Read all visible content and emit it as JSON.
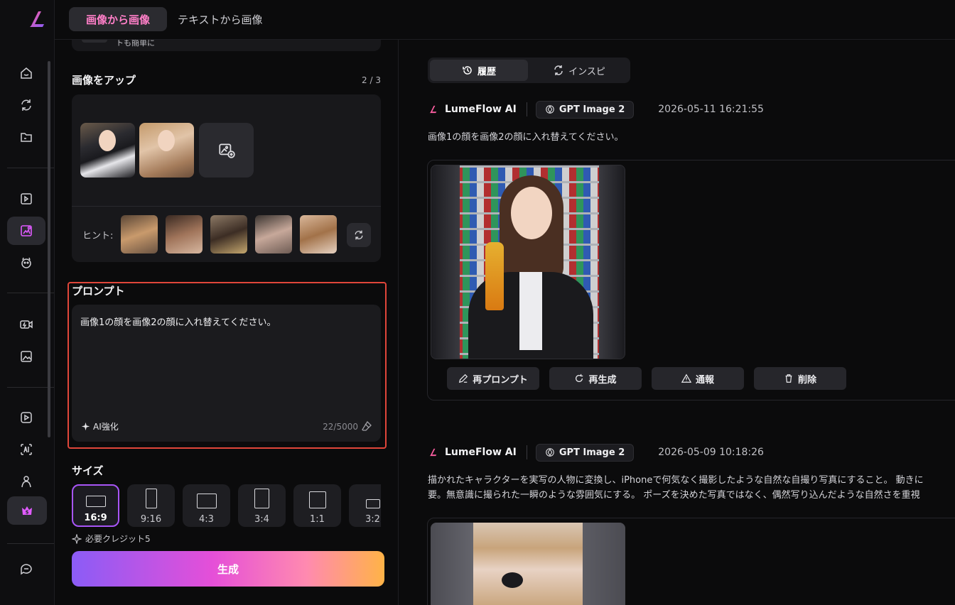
{
  "header": {
    "tabs": [
      {
        "label": "画像から画像",
        "active": true
      },
      {
        "label": "テキストから画像",
        "active": false
      }
    ]
  },
  "sidebar": {
    "icons": [
      "home-icon",
      "refresh-icon",
      "folder-icon",
      "ai-video-icon",
      "image-edit-icon",
      "pet-icon",
      "camera-icon",
      "image-icon",
      "video-play-icon",
      "ai-text-icon",
      "avatar-icon",
      "premium-icon",
      "chat-icon"
    ]
  },
  "left_panel": {
    "previous_card_text": "トも簡単に",
    "upload": {
      "title": "画像をアップ",
      "count": "2 / 3",
      "hint_label": "ヒント:"
    },
    "prompt": {
      "title": "プロンプト",
      "text": "画像1の顔を画像2の顔に入れ替えてください。",
      "ai_enhance": "AI強化",
      "char_count": "22/5000"
    },
    "size": {
      "title": "サイズ",
      "options": [
        "16:9",
        "9:16",
        "4:3",
        "3:4",
        "1:1",
        "3:2"
      ],
      "selected": "16:9"
    },
    "credits": "必要クレジット5",
    "generate_label": "生成"
  },
  "history": {
    "tabs": [
      {
        "label": "履歴",
        "active": true
      },
      {
        "label": "インスピ",
        "active": false
      }
    ],
    "entries": [
      {
        "brand": "LumeFlow AI",
        "model": "GPT Image 2",
        "date": "2026-05-11 16:21:55",
        "prompt": "画像1の顔を画像2の顔に入れ替えてください。",
        "actions": [
          "再プロンプト",
          "再生成",
          "通報",
          "削除"
        ]
      },
      {
        "brand": "LumeFlow AI",
        "model": "GPT Image 2",
        "date": "2026-05-09 10:18:26",
        "prompt_line1": "描かれたキャラクターを実写の人物に変換し、iPhoneで何気なく撮影したような自然な自撮り写真にすること。 動きに",
        "prompt_line2": "要。無意識に撮られた一瞬のような雰囲気にする。 ポーズを決めた写真ではなく、偶然写り込んだような自然さを重視"
      }
    ]
  },
  "colors": {
    "accent_pink": "#ff7fc8",
    "accent_purple": "#a855f7",
    "highlight_border": "#e0463a"
  }
}
